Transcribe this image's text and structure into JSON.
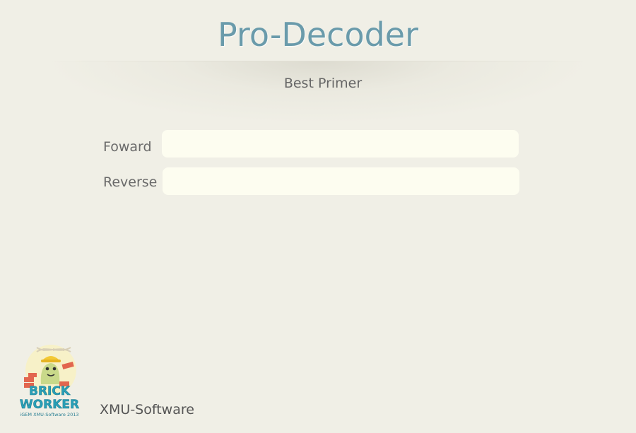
{
  "header": {
    "title": "Pro-Decoder",
    "subtitle": "Best Primer"
  },
  "form": {
    "forward": {
      "label": "Foward",
      "value": ""
    },
    "reverse": {
      "label": "Reverse",
      "value": ""
    }
  },
  "footer": {
    "logo_line1": "BRICK",
    "logo_line2": "WORKER",
    "logo_caption": "iGEM XMU-Software 2013",
    "credit": "XMU-Software"
  },
  "colors": {
    "background": "#f0efe6",
    "title": "#6a9bab",
    "input_background": "#fdfdf0",
    "logo_text": "#2aa0b8"
  }
}
